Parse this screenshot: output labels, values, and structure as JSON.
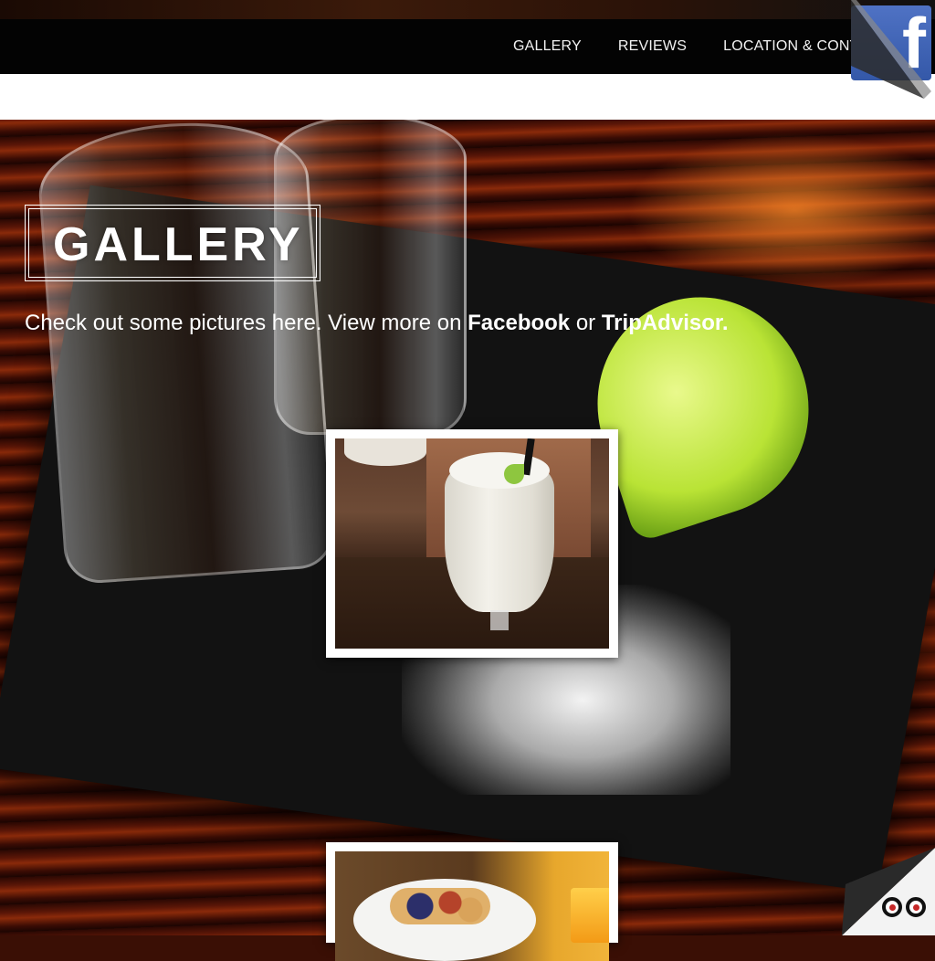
{
  "nav": {
    "items": [
      {
        "label": "GALLERY"
      },
      {
        "label": "REVIEWS"
      },
      {
        "label": "LOCATION & CONTACT"
      }
    ]
  },
  "social": {
    "facebook_icon": "facebook-icon",
    "facebook_glyph": "f",
    "tripadvisor_icon": "tripadvisor-owl-icon"
  },
  "gallery": {
    "heading": "GALLERY",
    "intro_text": "Check out some pictures here. View more on ",
    "facebook_link": "Facebook",
    "or_text": " or ",
    "tripadvisor_link": "TripAdvisor."
  },
  "colors": {
    "nav_bg": "#030303",
    "facebook_blue": "#3b5998",
    "text": "#ffffff"
  }
}
